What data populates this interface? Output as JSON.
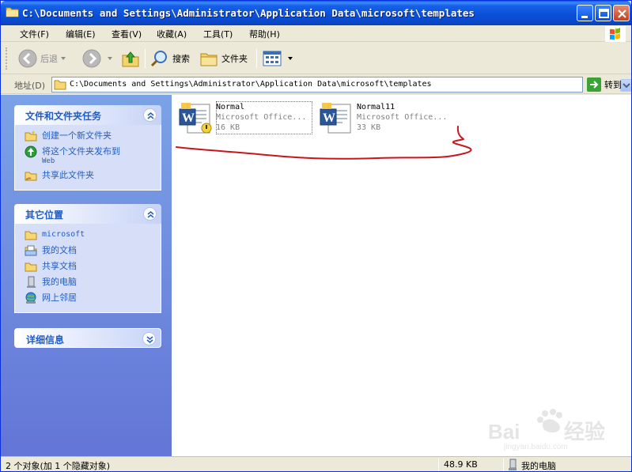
{
  "window": {
    "title": "C:\\Documents and Settings\\Administrator\\Application Data\\microsoft\\templates"
  },
  "menu": {
    "items": [
      "文件(F)",
      "编辑(E)",
      "查看(V)",
      "收藏(A)",
      "工具(T)",
      "帮助(H)"
    ]
  },
  "toolbar": {
    "back_label": "后退",
    "search_label": "搜索",
    "folders_label": "文件夹"
  },
  "address": {
    "label": "地址(D)",
    "value": "C:\\Documents and Settings\\Administrator\\Application Data\\microsoft\\templates",
    "go_label": "转到"
  },
  "sidebar": {
    "tasks": {
      "title": "文件和文件夹任务",
      "items": [
        {
          "label": "创建一个新文件夹",
          "icon": "new-folder-icon"
        },
        {
          "label": "将这个文件夹发布到",
          "sub": "Web",
          "icon": "publish-web-icon"
        },
        {
          "label": "共享此文件夹",
          "icon": "share-folder-icon"
        }
      ]
    },
    "places": {
      "title": "其它位置",
      "items": [
        {
          "label": "microsoft",
          "icon": "folder-icon"
        },
        {
          "label": "我的文档",
          "icon": "my-documents-icon"
        },
        {
          "label": "共享文档",
          "icon": "shared-documents-icon"
        },
        {
          "label": "我的电脑",
          "icon": "my-computer-icon"
        },
        {
          "label": "网上邻居",
          "icon": "network-places-icon"
        }
      ]
    },
    "details": {
      "title": "详细信息"
    }
  },
  "files": [
    {
      "name": "Normal",
      "type": "Microsoft Office...",
      "size": "16 KB",
      "hidden": true
    },
    {
      "name": "Normal11",
      "type": "Microsoft Office...",
      "size": "33 KB",
      "hidden": false
    }
  ],
  "status": {
    "objects": "2 个对象(加 1 个隐藏对象)",
    "size": "48.9 KB",
    "location": "我的电脑"
  },
  "colors": {
    "title_bar": "#0b4fd8",
    "sidebar_bg": "#7ba2e7",
    "link": "#215dc6",
    "annotation": "#c8161d"
  }
}
